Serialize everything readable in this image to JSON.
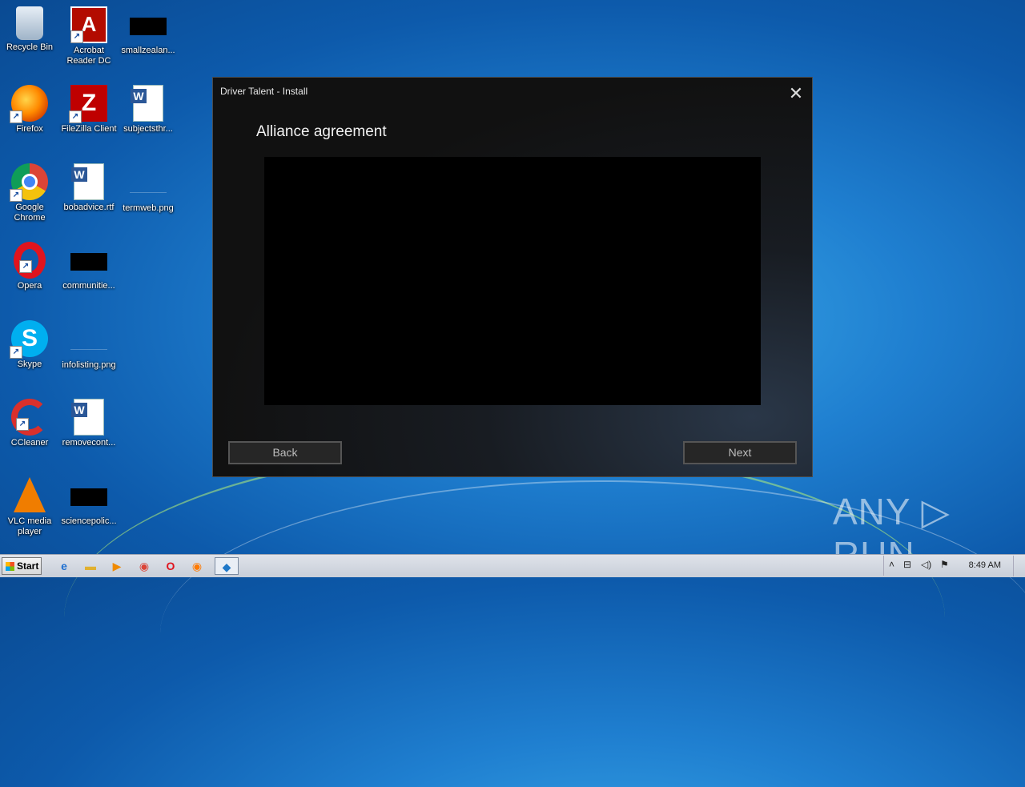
{
  "desktop": {
    "icons": [
      {
        "label": "Recycle Bin",
        "glyph": ""
      },
      {
        "label": "Acrobat Reader DC",
        "glyph": "A"
      },
      {
        "label": "smallzealan...",
        "glyph": ""
      },
      {
        "label": "Firefox",
        "glyph": ""
      },
      {
        "label": "FileZilla Client",
        "glyph": "Z"
      },
      {
        "label": "subjectsthr...",
        "glyph": "W"
      },
      {
        "label": "Google Chrome",
        "glyph": ""
      },
      {
        "label": "bobadvice.rtf",
        "glyph": "W"
      },
      {
        "label": "termweb.png",
        "glyph": ""
      },
      {
        "label": "Opera",
        "glyph": ""
      },
      {
        "label": "communitie...",
        "glyph": ""
      },
      {
        "label": "Skype",
        "glyph": "S"
      },
      {
        "label": "infolisting.png",
        "glyph": ""
      },
      {
        "label": "CCleaner",
        "glyph": ""
      },
      {
        "label": "removecont...",
        "glyph": "W"
      },
      {
        "label": "VLC media player",
        "glyph": ""
      },
      {
        "label": "sciencepolic..."
      }
    ],
    "shortcut_glyph": "↗"
  },
  "dialog": {
    "title": "Driver Talent - Install",
    "close_glyph": "✕",
    "heading": "Alliance agreement",
    "back_label": "Back",
    "next_label": "Next"
  },
  "watermark": "ANY ▷ RUN",
  "taskbar": {
    "start_label": "Start",
    "items": [
      {
        "name": "ie-icon",
        "glyph": "e",
        "color": "#1e6fd0"
      },
      {
        "name": "explorer-icon",
        "glyph": "▬",
        "color": "#e0b030"
      },
      {
        "name": "media-player-icon",
        "glyph": "▶",
        "color": "#f08a00"
      },
      {
        "name": "chrome-icon",
        "glyph": "◉",
        "color": "#db4437"
      },
      {
        "name": "opera-icon",
        "glyph": "O",
        "color": "#e0141e"
      },
      {
        "name": "firefox-icon",
        "glyph": "◉",
        "color": "#ff7a00"
      },
      {
        "name": "driver-talent-icon",
        "glyph": "◆",
        "color": "#1e78c8"
      }
    ],
    "tray": {
      "chevron": "˄",
      "network_glyph": "⊟",
      "volume_glyph": "◁)",
      "flag_glyph": "⚑",
      "clock": "8:49 AM"
    }
  }
}
